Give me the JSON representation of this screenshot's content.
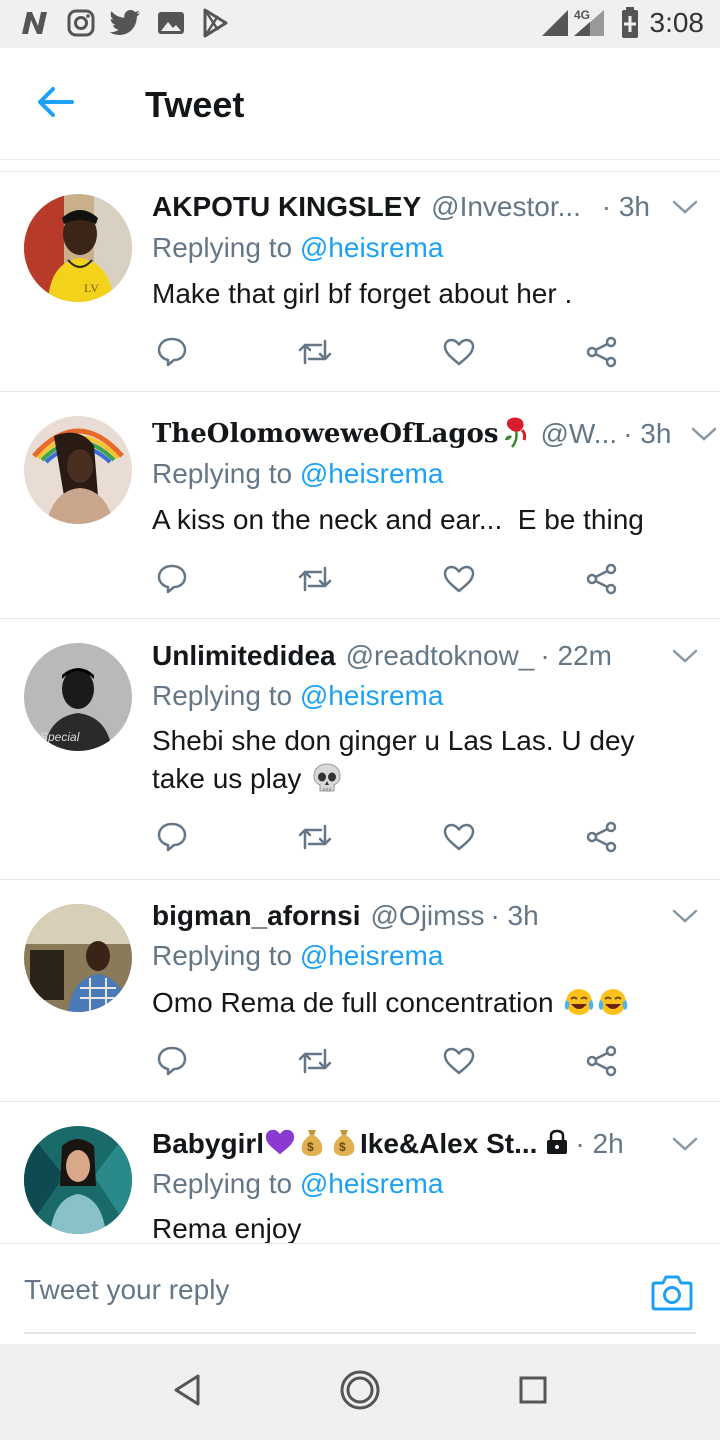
{
  "status_bar": {
    "time": "3:08",
    "network": "4G",
    "left_icons": [
      "n-logo-icon",
      "instagram-icon",
      "twitter-icon",
      "gallery-icon",
      "play-store-icon"
    ]
  },
  "header": {
    "title": "Tweet",
    "back_icon": "arrow-left-icon"
  },
  "colors": {
    "accent": "#1da1f2",
    "secondary_text": "#657786",
    "primary_text": "#14171a",
    "divider": "#e1e8ed",
    "system_bar": "#f0f0f0"
  },
  "tweets": [
    {
      "name": "AKPOTU KINGSLEY",
      "handle": "@Investor...",
      "time": "· 3h",
      "replying_prefix": "Replying to ",
      "replying_to": "@heisrema",
      "text": "Make that girl bf forget about her ."
    },
    {
      "name": "TheOlomoweweOfLagos",
      "handle": "@W...",
      "time": "· 3h",
      "replying_prefix": "Replying to ",
      "replying_to": "@heisrema",
      "text": "A kiss on the neck and ear...  E be thing"
    },
    {
      "name": "Unlimitedidea",
      "handle": "@readtoknow_",
      "time": "· 22m",
      "replying_prefix": "Replying to ",
      "replying_to": "@heisrema",
      "text_line1": "Shebi she don ginger u Las Las. U dey",
      "text_line2": "take us play"
    },
    {
      "name": "bigman_afornsi",
      "handle": "@Ojimss",
      "time": "· 3h",
      "replying_prefix": "Replying to ",
      "replying_to": "@heisrema",
      "text": "Omo Rema de full concentration"
    },
    {
      "name_part1": "Babygirl",
      "name_part2": "Ike&Alex St...",
      "time": "· 2h",
      "replying_prefix": "Replying to ",
      "replying_to": "@heisrema",
      "text": "Rema enjoy"
    }
  ],
  "reply_bar": {
    "placeholder": "Tweet your reply"
  },
  "nav_bar": {
    "buttons": [
      "back-triangle-icon",
      "home-circle-icon",
      "recents-square-icon"
    ]
  }
}
